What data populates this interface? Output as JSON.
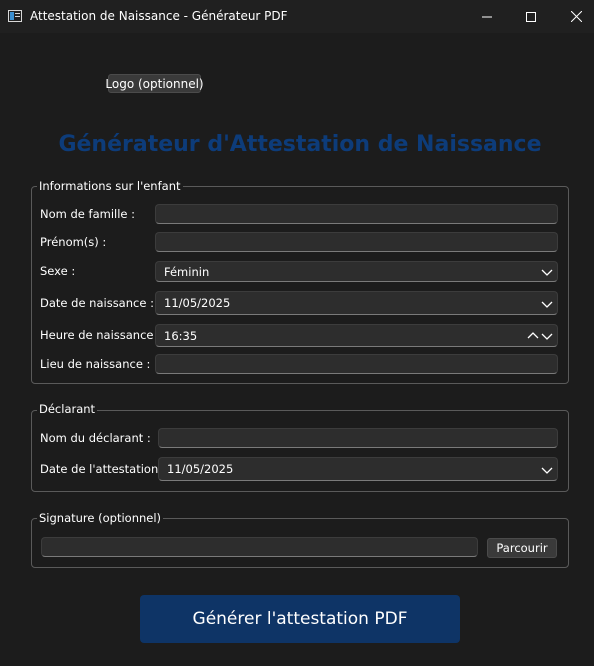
{
  "window": {
    "title": "Attestation de Naissance - Générateur PDF",
    "icons": {
      "app": "app-icon",
      "minimize": "minimize-icon",
      "maximize": "maximize-icon",
      "close": "close-icon"
    }
  },
  "logo_button_label": "Logo (optionnel)",
  "main_title": "Générateur d'Attestation de Naissance",
  "accent_color": "#0d3c7a",
  "child_group": {
    "title": "Informations sur l'enfant",
    "last_name": {
      "label": "Nom de famille :",
      "value": ""
    },
    "first_names": {
      "label": "Prénom(s) :",
      "value": ""
    },
    "sex": {
      "label": "Sexe :",
      "value": "Féminin"
    },
    "birth_date": {
      "label": "Date de naissance :",
      "value": "11/05/2025"
    },
    "birth_time": {
      "label": "Heure de naissance :",
      "value": "16:35"
    },
    "birth_place": {
      "label": "Lieu de naissance :",
      "value": ""
    }
  },
  "declarant_group": {
    "title": "Déclarant",
    "name": {
      "label": "Nom du déclarant :",
      "value": ""
    },
    "attestation_date": {
      "label": "Date de l'attestation :",
      "value": "11/05/2025"
    }
  },
  "signature_group": {
    "title": "Signature (optionnel)",
    "path_value": "",
    "browse_label": "Parcourir"
  },
  "generate_button_label": "Générer l'attestation PDF"
}
